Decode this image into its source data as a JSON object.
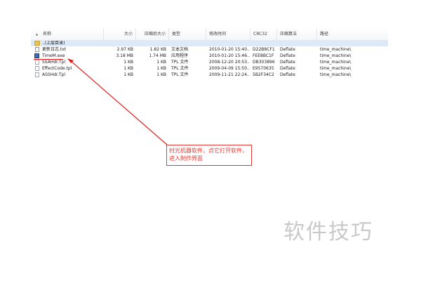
{
  "columns": [
    {
      "label": "名称"
    },
    {
      "label": "大小"
    },
    {
      "label": "压缩后大小"
    },
    {
      "label": "类型"
    },
    {
      "label": "修改时间"
    },
    {
      "label": "CRC32"
    },
    {
      "label": "压缩算法"
    },
    {
      "label": "路径"
    }
  ],
  "files": [
    {
      "name": "..(上层目录)",
      "size": "",
      "packed": "",
      "type": "",
      "modified": "",
      "crc": "",
      "method": "",
      "path": "",
      "icon": "folder-icon",
      "selected": true
    },
    {
      "name": "更新日志.txt",
      "size": "2.97 KB",
      "packed": "1.82 KB",
      "type": "文本文档",
      "modified": "2010-01-20 15:40...",
      "crc": "D22B8CF1",
      "method": "Deflate",
      "path": "time_machine\\",
      "icon": "text-file-icon",
      "selected": false
    },
    {
      "name": "TimeM.exe",
      "size": "3.18 MB",
      "packed": "1.74 MB",
      "type": "应用程序",
      "modified": "2010-01-20 15:46...",
      "crc": "FEE8BC1F",
      "method": "Deflate",
      "path": "time_machine\\",
      "icon": "exe-file-icon",
      "selected": false
    },
    {
      "name": "SSAHdr.Tpl",
      "size": "1 KB",
      "packed": "1 KB",
      "type": "TPL 文件",
      "modified": "2008-12-20 20:53...",
      "crc": "DB303896",
      "method": "Deflate",
      "path": "time_machine\\",
      "icon": "tpl-file-icon",
      "selected": false
    },
    {
      "name": "EffectCode.tpl",
      "size": "1 KB",
      "packed": "1 KB",
      "type": "TPL 文件",
      "modified": "2009-04-09 15:50...",
      "crc": "E9570635",
      "method": "Deflate",
      "path": "time_machine\\",
      "icon": "tpl-file-icon",
      "selected": false
    },
    {
      "name": "ASSHdr.Tpl",
      "size": "1 KB",
      "packed": "1 KB",
      "type": "TPL 文件",
      "modified": "2009-11-21 22:24...",
      "crc": "5B2F34C2",
      "method": "Deflate",
      "path": "time_machine\\",
      "icon": "tpl-file-icon",
      "selected": false
    }
  ],
  "annotation": {
    "text": "时光机器软件，点它打开软件，进入制作界面",
    "color": "#e53935"
  },
  "watermark": "软件技巧",
  "colors": {
    "selection": "#dbe9f9",
    "annotation": "#e53935",
    "watermark": "#c9c9c9"
  }
}
